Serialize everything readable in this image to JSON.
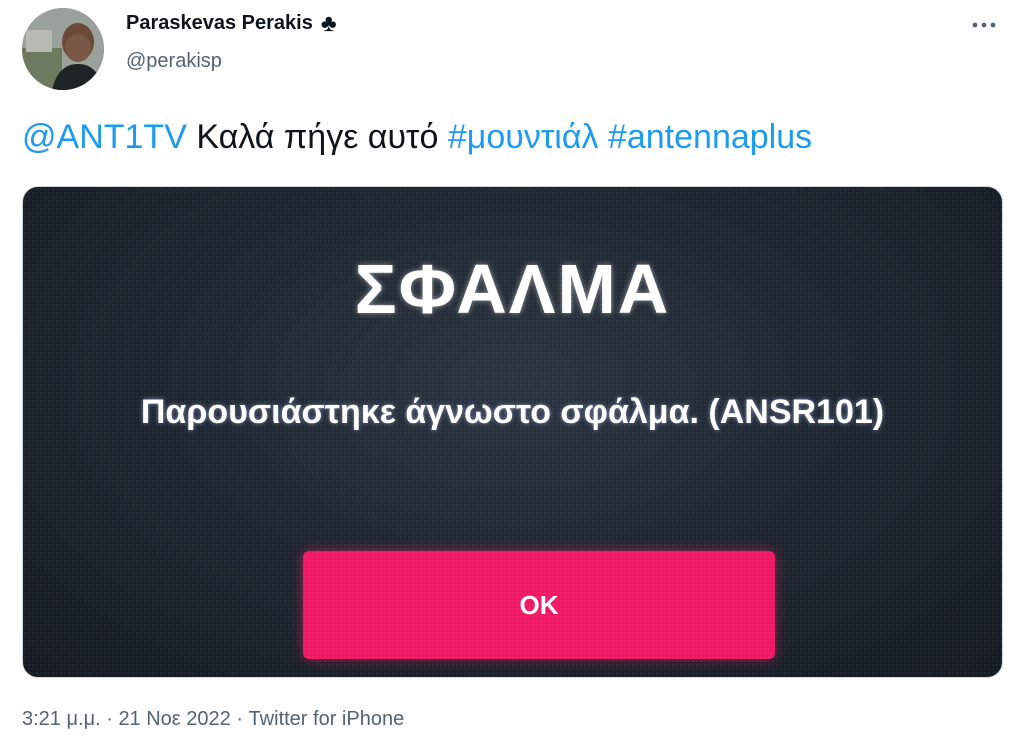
{
  "author": {
    "name": "Paraskevas Perakis",
    "badge_glyph": "♣",
    "handle": "@perakisp"
  },
  "tweet": {
    "mention": "@ANT1TV",
    "text": " Καλά πήγε αυτό ",
    "hashtag1": "#μουντιάλ",
    "hashtag2": "#antennaplus"
  },
  "media": {
    "title": "ΣΦΑΛΜΑ",
    "message": "Παρουσιάστηκε άγνωστο σφάλμα. (ANSR101)",
    "ok_label": "OK"
  },
  "meta": {
    "time": "3:21 μ.μ.",
    "sep1": " · ",
    "date": "21 Νοε 2022",
    "sep2": " · ",
    "source": "Twitter for iPhone"
  },
  "colors": {
    "link": "#1d9bf0",
    "secondary_text": "#536471",
    "ok_button": "#f01965"
  }
}
